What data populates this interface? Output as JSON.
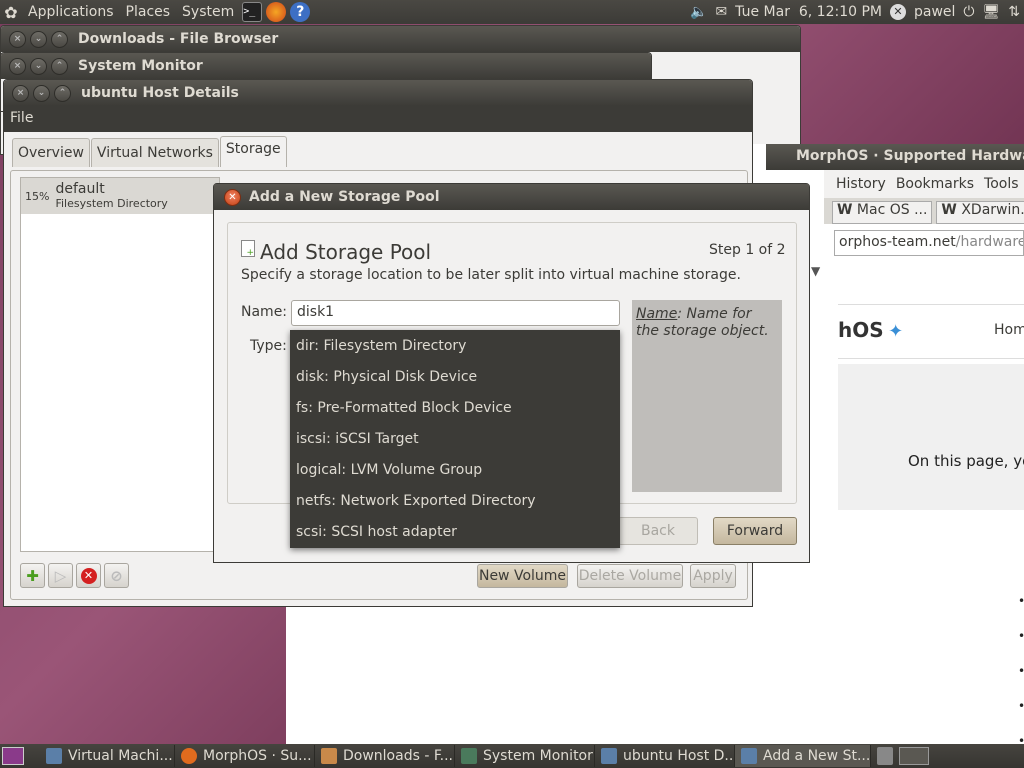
{
  "top_panel": {
    "menus": [
      "Applications",
      "Places",
      "System"
    ],
    "datetime": "Tue Mar  6, 12:10 PM",
    "user": "pawel"
  },
  "windows": {
    "file_browser_title": "Downloads - File Browser",
    "system_monitor_title": "System Monitor",
    "host_details": {
      "title": "ubuntu Host Details",
      "menu": "File",
      "tabs": [
        "Overview",
        "Virtual Networks",
        "Storage"
      ],
      "pool": {
        "percent": "15%",
        "name": "default",
        "type": "Filesystem Directory"
      },
      "buttons": {
        "new_volume": "New Volume",
        "delete_volume": "Delete Volume",
        "apply": "Apply"
      }
    },
    "browser": {
      "title": "MorphOS · Supported Hardwa",
      "menus": [
        "History",
        "Bookmarks",
        "Tools",
        "H"
      ],
      "tabs": [
        "Mac OS ...",
        "XDarwin..."
      ],
      "url_domain": "orphos-team.net",
      "url_path": "/hardware.ht",
      "logo": "hOS",
      "home": "Hom",
      "body_text": "On this page, yo"
    }
  },
  "dialog": {
    "title": "Add a New Storage Pool",
    "heading": "Add Storage Pool",
    "step": "Step 1 of 2",
    "description": "Specify a storage location to be later split into virtual machine storage.",
    "name_label": "Name:",
    "name_value": "disk1",
    "type_label": "Type:",
    "type_options": [
      "dir: Filesystem Directory",
      "disk: Physical Disk Device",
      "fs: Pre-Formatted Block Device",
      "iscsi: iSCSI Target",
      "logical: LVM Volume Group",
      "netfs: Network Exported Directory",
      "scsi: SCSI host adapter"
    ],
    "help_term": "Name",
    "help_text": ": Name for the storage object.",
    "back_label": "Back",
    "forward_label": "Forward"
  },
  "taskbar": [
    {
      "label": "Virtual Machi...",
      "color": "#5b7fa8"
    },
    {
      "label": "MorphOS · Su...",
      "color": "#e06b1e"
    },
    {
      "label": "Downloads - F...",
      "color": "#c9894a"
    },
    {
      "label": "System Monitor",
      "color": "#4a7a5c"
    },
    {
      "label": "ubuntu Host D...",
      "color": "#5b7fa8"
    },
    {
      "label": "Add a New St...",
      "color": "#5b7fa8"
    }
  ]
}
